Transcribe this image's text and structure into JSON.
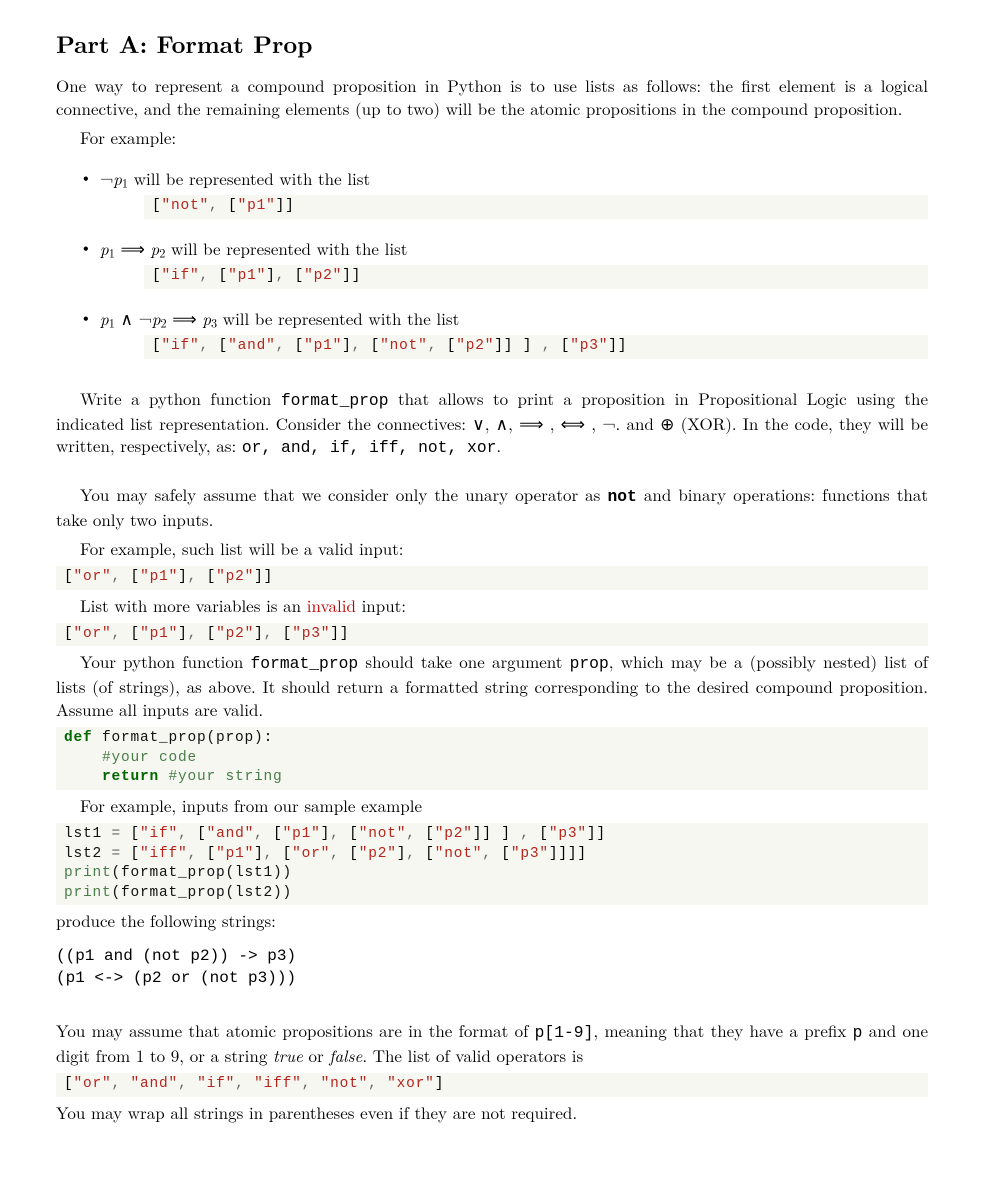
{
  "title": "Part A: Format Prop",
  "intro": "One way to represent a compound proposition in Python is to use lists as follows: the first element is a logical connective, and the remaining elements (up to two) will be the atomic propositions in the compound proposition.",
  "for_example": "For example:",
  "bullets": {
    "b1_suffix": " will be represented with the list",
    "b1_code": "[\"not\", [\"p1\"]]",
    "b2_suffix": " will be represented with the list",
    "b2_code": "[\"if\", [\"p1\"], [\"p2\"]]",
    "b3_suffix": " will be represented with the list",
    "b3_code": "[\"if\", [\"and\", [\"p1\"], [\"not\", [\"p2\"]] ] , [\"p3\"]]"
  },
  "write_fn_pre": "Write a python function ",
  "write_fn_name": "format_prop",
  "write_fn_mid": " that allows to print a proposition in Propositional Logic using the indicated list representation. Consider the connectives: ∨, ∧,   ⟹ ,   ⟺ , ¬. and ⊕ (XOR). In the code, they will be written, respectively, as: ",
  "write_fn_ops": "or, and, if, iff, not, xor",
  "write_fn_end": ".",
  "assume_pre": "You may safely assume that we consider only the unary operator as ",
  "assume_not": "not",
  "assume_post": " and binary operations: functions that take only two inputs.",
  "valid_line": "For example, such list will be a valid input:",
  "valid_code": "[\"or\", [\"p1\"], [\"p2\"]]",
  "invalid_pre": "List with more variables is an ",
  "invalid_word": "invalid",
  "invalid_post": " input:",
  "invalid_code": "[\"or\", [\"p1\"], [\"p2\"], [\"p3\"]]",
  "fn_desc_pre": "Your python function ",
  "fn_desc_mid1": " should take one argument ",
  "fn_desc_arg": "prop",
  "fn_desc_mid2": ", which may be a (possibly nested) list of lists (of strings), as above. It should return a formatted string corresponding to the desired compound proposition. Assume all inputs are valid.",
  "def_code": "def format_prop(prop):\n    #your code\n    return #your string",
  "sample_line": "For example, inputs from our sample example",
  "sample_code": "lst1 = [\"if\", [\"and\", [\"p1\"], [\"not\", [\"p2\"]] ] , [\"p3\"]]\nlst2 = [\"iff\", [\"p1\"], [\"or\", [\"p2\"], [\"not\", [\"p3\"]]]]\nprint(format_prop(lst1))\nprint(format_prop(lst2))",
  "produce_line": "produce the following strings:",
  "output_text": "((p1 and (not p2)) -> p3)\n(p1 <-> (p2 or (not p3)))",
  "assume2_pre": "You may assume that atomic propositions are in the format of ",
  "assume2_fmt": "p[1-9]",
  "assume2_mid": ", meaning that they have a prefix ",
  "assume2_p": "p",
  "assume2_mid2": " and one digit from 1 to 9, or a string ",
  "assume2_true": "true",
  "assume2_or": " or ",
  "assume2_false": "false",
  "assume2_end": ". The list of valid operators is",
  "ops_code": "[\"or\", \"and\", \"if\", \"iff\", \"not\", \"xor\"]",
  "wrap_line": "You may wrap all strings in parentheses even if they are not required.",
  "chart_data": null
}
